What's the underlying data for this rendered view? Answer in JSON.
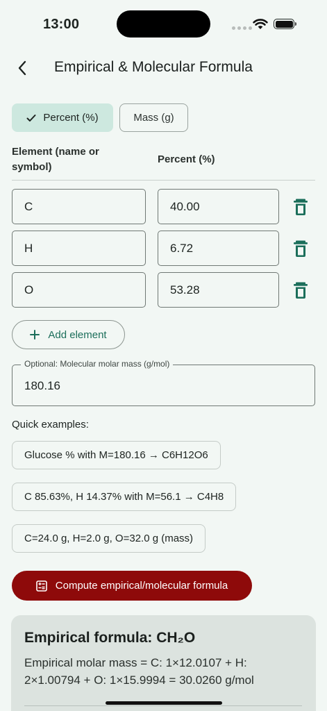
{
  "status": {
    "time": "13:00"
  },
  "header": {
    "title": "Empirical & Molecular Formula"
  },
  "mode": {
    "percent_label": "Percent (%)",
    "mass_label": "Mass (g)",
    "selected": "percent"
  },
  "columns": {
    "element": "Element (name or symbol)",
    "percent": "Percent (%)"
  },
  "rows": [
    {
      "element": "C",
      "value": "40.00"
    },
    {
      "element": "H",
      "value": "6.72"
    },
    {
      "element": "O",
      "value": "53.28"
    }
  ],
  "add_element_label": "Add element",
  "molar": {
    "legend": "Optional: Molecular molar mass (g/mol)",
    "value": "180.16"
  },
  "quick": {
    "label": "Quick examples:",
    "examples": [
      "Glucose % with M=180.16 → C6H12O6",
      "C 85.63%, H 14.37% with M=56.1 → C4H8",
      "C=24.0 g, H=2.0 g, O=32.0 g (mass)"
    ]
  },
  "compute_label": "Compute empirical/molecular formula",
  "result": {
    "title": "Empirical formula:  CH₂O",
    "molar_line": "Empirical molar mass = C: 1×12.0107  +  H: 2×1.00794  +  O: 1×15.9994 = 30.0260 g/mol"
  },
  "colors": {
    "accent": "#1b6e5a",
    "selected_chip": "#cde8df",
    "compute": "#8e0a0a",
    "background": "#f2f7f4"
  }
}
